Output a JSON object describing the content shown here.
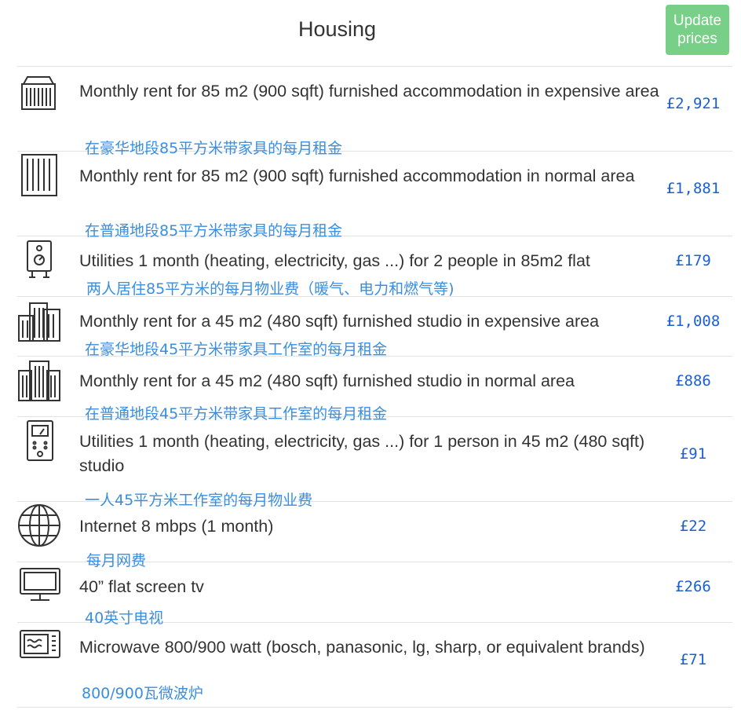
{
  "header": {
    "title": "Housing",
    "update_label_line1": "Update",
    "update_label_line2": "prices"
  },
  "items": [
    {
      "icon": "apartment-building-icon",
      "label": "Monthly rent for 85 m2 (900 sqft) furnished accommodation in expensive area",
      "price": "£2,921",
      "translation": "在豪华地段85平方米带家具的每月租金"
    },
    {
      "icon": "tall-building-icon",
      "label": "Monthly rent for 85 m2 (900 sqft) furnished accommodation in normal area",
      "price": "£1,881",
      "translation": "在普通地段85平方米带家具的每月租金"
    },
    {
      "icon": "boiler-icon",
      "label": "Utilities 1 month (heating, electricity, gas ...) for 2 people in 85m2 flat",
      "price": "£179",
      "translation": "两人居住85平方米的每月物业费（暖气、电力和燃气等)"
    },
    {
      "icon": "city-buildings-icon",
      "label": "Monthly rent for a 45 m2 (480 sqft) furnished studio in expensive area",
      "price": "£1,008",
      "translation": "在豪华地段45平方米带家具工作室的每月租金"
    },
    {
      "icon": "office-buildings-icon",
      "label": "Monthly rent for a 45 m2 (480 sqft) furnished studio in normal area",
      "price": "£886",
      "translation": "在普通地段45平方米带家具工作室的每月租金"
    },
    {
      "icon": "utility-meter-icon",
      "label": "Utilities 1 month (heating, electricity, gas ...) for 1 person in 45 m2 (480 sqft) studio",
      "price": "£91",
      "translation": "一人45平方米工作室的每月物业费"
    },
    {
      "icon": "globe-icon",
      "label": "Internet 8 mbps (1 month)",
      "price": "£22",
      "translation": "每月网费"
    },
    {
      "icon": "tv-icon",
      "label": "40” flat screen tv",
      "price": "£266",
      "translation": "40英寸电视"
    },
    {
      "icon": "microwave-icon",
      "label": "Microwave 800/900 watt (bosch, panasonic, lg, sharp, or equivalent brands)",
      "price": "£71",
      "translation": "800/900瓦微波炉"
    }
  ],
  "colors": {
    "button": "#78cf87",
    "price": "#1b5fd6",
    "translation": "#3a8ee0",
    "text": "#333333",
    "divider": "#e2e2e2"
  }
}
